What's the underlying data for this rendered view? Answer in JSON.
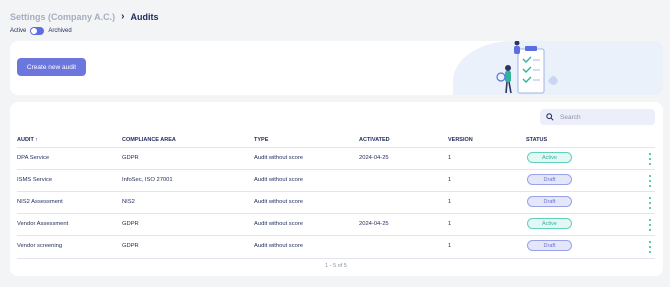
{
  "breadcrumb": {
    "parent": "Settings (Company A.C.)",
    "separator": "›",
    "current": "Audits"
  },
  "filter": {
    "left_label": "Active",
    "right_label": "Archived",
    "state": "active"
  },
  "banner": {
    "create_label": "Create new audit"
  },
  "search": {
    "placeholder": "Search"
  },
  "table": {
    "columns": [
      "AUDIT ↑",
      "COMPLIANCE AREA",
      "TYPE",
      "ACTIVATED",
      "VERSION",
      "STATUS"
    ],
    "rows": [
      {
        "audit": "DPA Service",
        "area": "GDPR",
        "type": "Audit without score",
        "activated": "2024-04-25",
        "version": "1",
        "status": "Active"
      },
      {
        "audit": "ISMS Service",
        "area": "InfoSec, ISO 27001",
        "type": "Audit without score",
        "activated": "",
        "version": "1",
        "status": "Draft"
      },
      {
        "audit": "NIS2 Assessment",
        "area": "NIS2",
        "type": "Audit without score",
        "activated": "",
        "version": "1",
        "status": "Draft"
      },
      {
        "audit": "Vendor Assessment",
        "area": "GDPR",
        "type": "Audit without score",
        "activated": "2024-04-25",
        "version": "1",
        "status": "Active"
      },
      {
        "audit": "Vendor screening",
        "area": "GDPR",
        "type": "Audit without score",
        "activated": "",
        "version": "1",
        "status": "Draft"
      }
    ]
  },
  "pagination": {
    "text": "1 - 5 of 5"
  },
  "colors": {
    "primary": "#6c77dd",
    "active": "#2fb49c",
    "draft": "#6c74c8",
    "text": "#1e2a5a"
  }
}
